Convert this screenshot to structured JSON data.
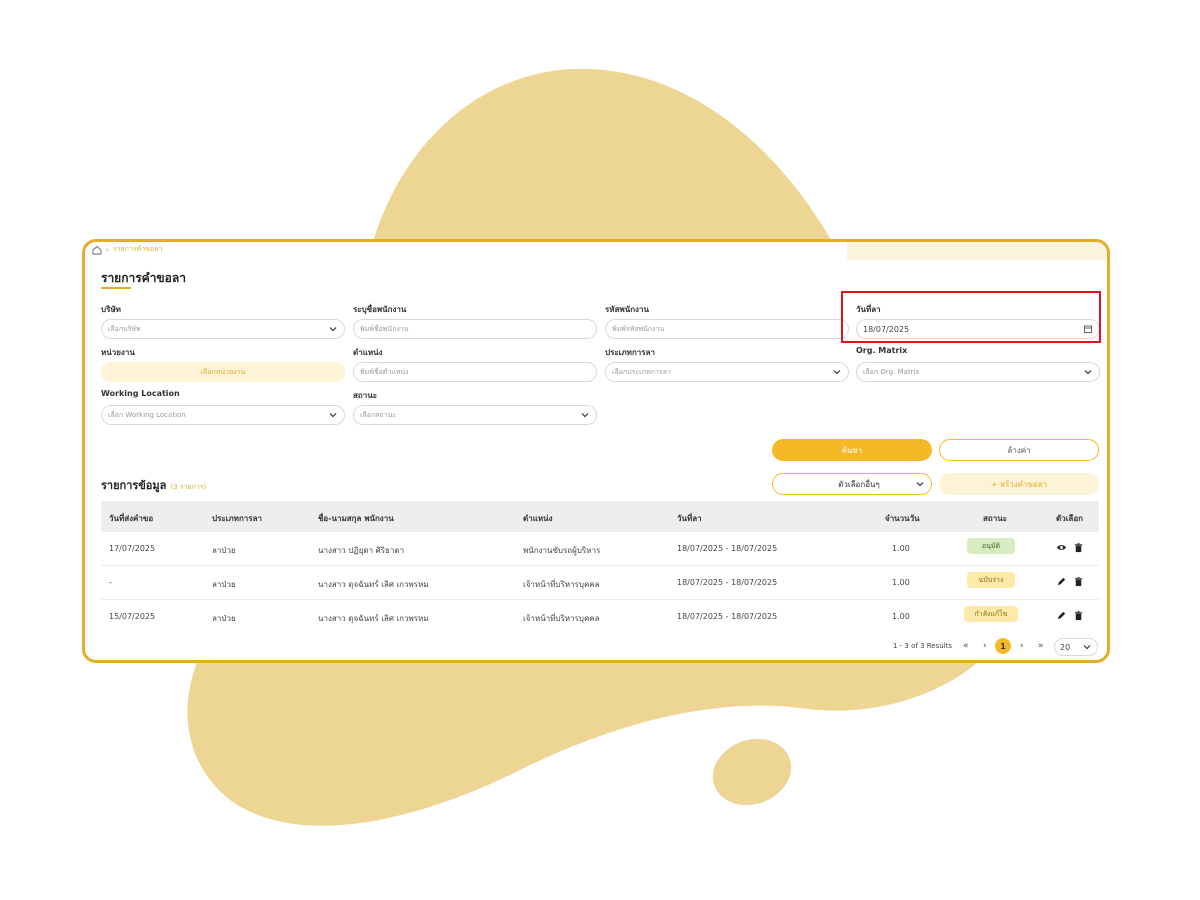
{
  "colors": {
    "accent": "#f5b928",
    "border": "#e3ad2a",
    "blob": "#edd594",
    "highlight": "#e0141b",
    "approved_bg": "#d8ecc4",
    "pending_bg": "#fdeaa9"
  },
  "breadcrumb": {
    "home_icon": "home-icon",
    "current": "รายการคำขอลา"
  },
  "page": {
    "title": "รายการคำขอลา"
  },
  "filters": {
    "company": {
      "label": "บริษัท",
      "placeholder": "เลือกบริษัท"
    },
    "employee_name": {
      "label": "ระบุชื่อพนักงาน",
      "placeholder": "พิมพ์ชื่อพนักงาน"
    },
    "employee_code": {
      "label": "รหัสพนักงาน",
      "placeholder": "พิมพ์รหัสพนักงาน"
    },
    "leave_date": {
      "label": "วันที่ลา",
      "value": "18/07/2025"
    },
    "unit": {
      "label": "หน่วยงาน",
      "placeholder": "เลือกหน่วยงาน"
    },
    "position": {
      "label": "ตำแหน่ง",
      "placeholder": "พิมพ์ชื่อตำแหน่ง"
    },
    "leave_type": {
      "label": "ประเภทการลา",
      "placeholder": "เลือกประเภทการลา"
    },
    "org_matrix": {
      "label": "Org. Matrix",
      "placeholder": "เลือก Org. Matrix"
    },
    "working_location": {
      "label": "Working Location",
      "placeholder": "เลือก Working Location"
    },
    "status": {
      "label": "สถานะ",
      "placeholder": "เลือกสถานะ"
    }
  },
  "actions": {
    "search": "ค้นหา",
    "clear": "ล้างค่า",
    "more_options": "ตัวเลือกอื่นๆ",
    "create": "+ สร้างคำขอลา"
  },
  "list": {
    "title": "รายการข้อมูล",
    "count": "(3 รายการ)"
  },
  "table": {
    "headers": [
      "วันที่ส่งคำขอ",
      "ประเภทการลา",
      "ชื่อ-นามสกุล พนักงาน",
      "ตำแหน่ง",
      "วันที่ลา",
      "จำนวนวัน",
      "สถานะ",
      "ตัวเลือก"
    ],
    "rows": [
      {
        "submitted": "17/07/2025",
        "type": "ลาป่วย",
        "name": "นางสาว ปฏิยุดา ศิริธาดา",
        "position": "พนักงานขับรถผู้บริหาร",
        "leave_dates": "18/07/2025 - 18/07/2025",
        "days": "1.00",
        "status": "อนุมัติ",
        "status_kind": "approved",
        "actions": [
          "eye-icon",
          "trash-icon"
        ]
      },
      {
        "submitted": "-",
        "type": "ลาป่วย",
        "name": "นางสาว ดุจฉันทร์ เลิศ เกวพรหม",
        "position": "เจ้าหน้าที่บริหารบุคคล",
        "leave_dates": "18/07/2025 - 18/07/2025",
        "days": "1.00",
        "status": "ฉบับร่าง",
        "status_kind": "draft",
        "actions": [
          "pen-icon",
          "trash-icon"
        ]
      },
      {
        "submitted": "15/07/2025",
        "type": "ลาป่วย",
        "name": "นางสาว ดุจฉันทร์ เลิศ เกวพรหม",
        "position": "เจ้าหน้าที่บริหารบุคคล",
        "leave_dates": "18/07/2025 - 18/07/2025",
        "days": "1.00",
        "status": "กำลังแก้ไข",
        "status_kind": "pending",
        "actions": [
          "pen-icon",
          "trash-icon"
        ]
      }
    ]
  },
  "pagination": {
    "summary": "1 - 3 of 3 Results",
    "first": "«",
    "prev": "‹",
    "current": "1",
    "next": "›",
    "last": "»",
    "page_size": "20"
  }
}
